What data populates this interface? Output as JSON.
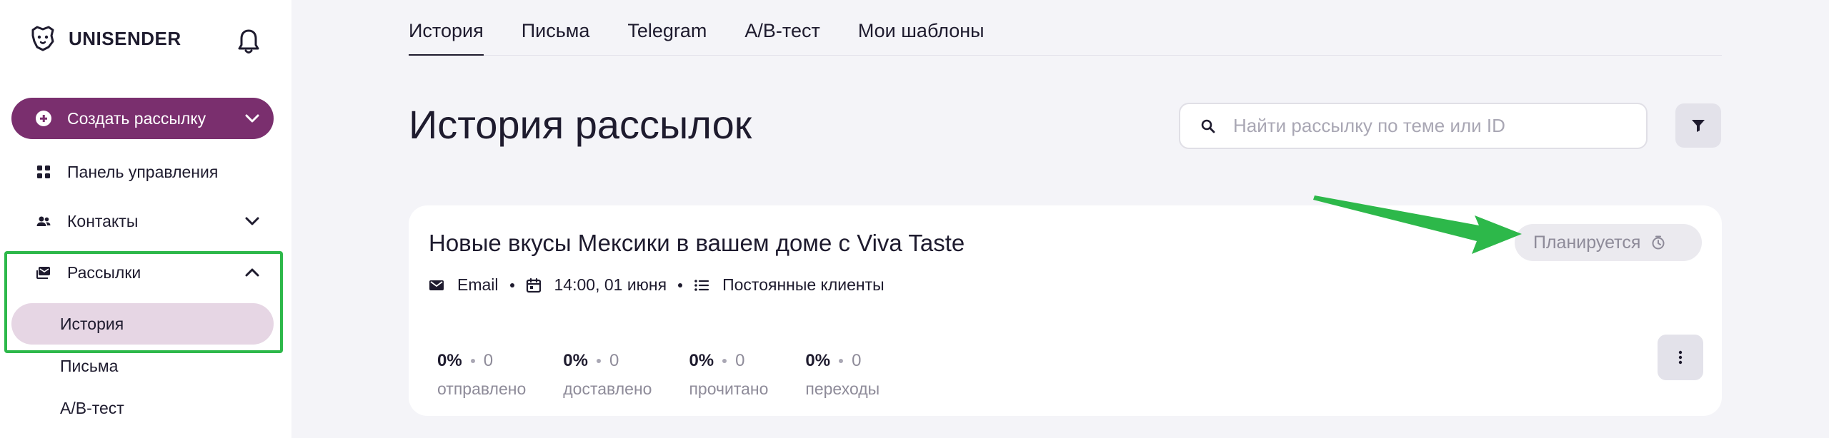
{
  "app": {
    "brand": "UNISENDER"
  },
  "sidebar": {
    "create_label": "Создать рассылку",
    "items": [
      {
        "label": "Панель управления",
        "icon": "grid-icon"
      },
      {
        "label": "Контакты",
        "icon": "people-icon"
      },
      {
        "label": "Рассылки",
        "icon": "mail-stack-icon"
      }
    ],
    "subitems": [
      {
        "label": "История",
        "active": true
      },
      {
        "label": "Письма"
      },
      {
        "label": "A/B-тест"
      }
    ]
  },
  "tabs": [
    {
      "label": "История",
      "active": true
    },
    {
      "label": "Письма"
    },
    {
      "label": "Telegram"
    },
    {
      "label": "A/B-тест"
    },
    {
      "label": "Мои шаблоны"
    }
  ],
  "page": {
    "title": "История рассылок"
  },
  "search": {
    "placeholder": "Найти рассылку по теме или ID",
    "value": ""
  },
  "campaign": {
    "title": "Новые вкусы Мексики в вашем доме с Viva Taste",
    "channel": "Email",
    "datetime": "14:00, 01 июня",
    "list": "Постоянные клиенты",
    "status": "Планируется",
    "stats": [
      {
        "pct": "0%",
        "count": "0",
        "label": "отправлено"
      },
      {
        "pct": "0%",
        "count": "0",
        "label": "доставлено"
      },
      {
        "pct": "0%",
        "count": "0",
        "label": "прочитано"
      },
      {
        "pct": "0%",
        "count": "0",
        "label": "переходы"
      }
    ]
  },
  "colors": {
    "accent": "#7a2f6e",
    "active_sub_bg": "#e6d6e4",
    "annotation_green": "#2db84a",
    "page_bg": "#f4f4f8"
  }
}
